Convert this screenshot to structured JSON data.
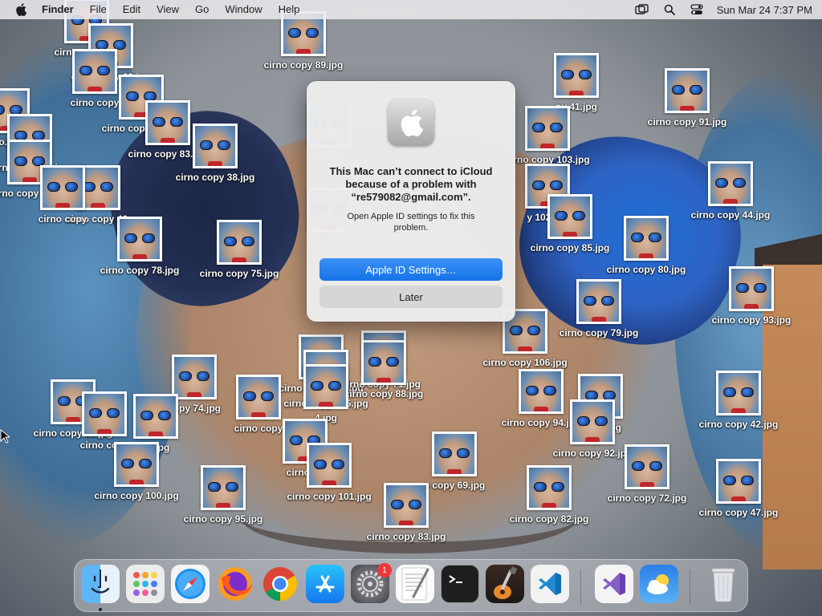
{
  "menubar": {
    "app_name": "Finder",
    "menus": [
      "File",
      "Edit",
      "View",
      "Go",
      "Window",
      "Help"
    ],
    "clock": "Sun Mar 24  7:37 PM",
    "status_icons": [
      "screen-mirroring-icon",
      "spotlight-search-icon",
      "control-center-icon"
    ]
  },
  "desktop": {
    "icons": [
      {
        "label": "cirno copy.jpg"
      },
      {
        "label": "cirno copy 89.jpg"
      },
      {
        "label": "cirno copy 63.jpg"
      },
      {
        "label": "cirno copy"
      },
      {
        "label": "cirno copy 81.jpg"
      },
      {
        "label": "cirno copy 83.jpg"
      },
      {
        "label": "no.jpg"
      },
      {
        "label": "cirno copy 62.jpg"
      },
      {
        "label": "cirno copy 61.jpg"
      },
      {
        "label": "cirno copy 38.jpg"
      },
      {
        "label": "cirno copy 46."
      },
      {
        "label": "cirno copy"
      },
      {
        "label": "cirno copy 78.jpg"
      },
      {
        "label": "cirno copy 75.jpg"
      },
      {
        "label": "cirno co"
      },
      {
        "label": "cirno"
      },
      {
        "label": "py 41.jpg"
      },
      {
        "label": "cirno copy 91.jpg"
      },
      {
        "label": "cirno copy 103.jpg"
      },
      {
        "label": "cirno copy 44.jpg"
      },
      {
        "label": "y 102.jpg"
      },
      {
        "label": "cirno copy 85.jpg"
      },
      {
        "label": "cirno copy 80.jpg"
      },
      {
        "label": "cirno copy 93.jpg"
      },
      {
        "label": "cirno copy 79.jpg"
      },
      {
        "label": "cirno copy 106.jpg"
      },
      {
        "label": "copy 74.jpg"
      },
      {
        "label": "cirno copy 107.jpg"
      },
      {
        "label": "irno copy 71.jpg"
      },
      {
        "label": "cirno copy 88.jpg"
      },
      {
        "label": "cirno copy 105.jpg"
      },
      {
        "label": "4.jpg"
      },
      {
        "label": "cirno copy"
      },
      {
        "label": "cirno copy 65.jpg"
      },
      {
        "label": "cirno copy"
      },
      {
        "label": "96.jpg"
      },
      {
        "label": "cirno copy 94.jpg"
      },
      {
        "label": "py 87.jpg"
      },
      {
        "label": "cirno copy 42.jpg"
      },
      {
        "label": "cirno copy 92.jpg"
      },
      {
        "label": "o copy 69.jpg"
      },
      {
        "label": "cirno co"
      },
      {
        "label": "cirno copy 100.jpg"
      },
      {
        "label": "cirno copy 101.jpg"
      },
      {
        "label": "cirno copy 72.jpg"
      },
      {
        "label": "cirno copy 95.jpg"
      },
      {
        "label": "cirno copy 82.jpg"
      },
      {
        "label": "cirno copy 47.jpg"
      },
      {
        "label": "cirno copy 83.jpg"
      }
    ]
  },
  "dialog": {
    "title": "This Mac can’t connect to iCloud because of a problem with “re579082@gmail.com”.",
    "message": "Open Apple ID settings to fix this problem.",
    "primary_button": "Apple ID Settings…",
    "secondary_button": "Later"
  },
  "dock": {
    "items": [
      {
        "name": "Finder",
        "icon": "finder-icon",
        "running": true
      },
      {
        "name": "Launchpad",
        "icon": "launchpad-icon"
      },
      {
        "name": "Safari",
        "icon": "safari-icon"
      },
      {
        "name": "Firefox",
        "icon": "firefox-icon"
      },
      {
        "name": "Chrome",
        "icon": "chrome-icon"
      },
      {
        "name": "App Store",
        "icon": "app-store-icon"
      },
      {
        "name": "System Settings",
        "icon": "system-settings-icon",
        "badge": "1"
      },
      {
        "name": "TextEdit",
        "icon": "textedit-icon"
      },
      {
        "name": "Terminal",
        "icon": "terminal-icon"
      },
      {
        "name": "GarageBand",
        "icon": "garageband-icon"
      },
      {
        "name": "Visual Studio Code",
        "icon": "vscode-icon"
      },
      {
        "name": "Visual Studio",
        "icon": "visual-studio-icon"
      },
      {
        "name": "Weather",
        "icon": "weather-icon"
      },
      {
        "name": "Trash",
        "icon": "trash-icon"
      }
    ]
  },
  "colors": {
    "accent": "#1a76ec",
    "badge": "#f0363a"
  }
}
